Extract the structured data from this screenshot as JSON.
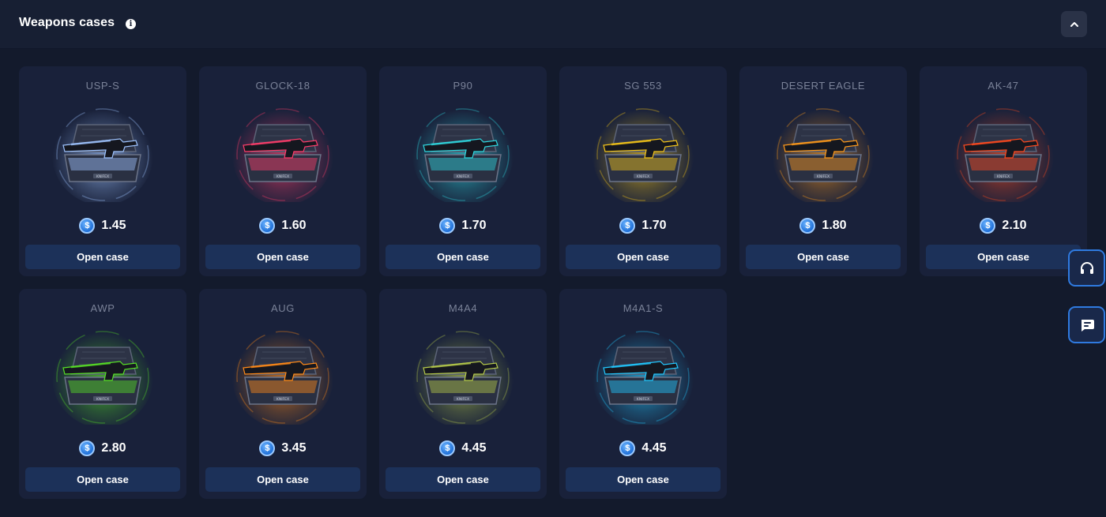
{
  "header": {
    "title": "Weapons cases",
    "info_icon": "info-icon",
    "collapse_icon": "chevron-up-icon"
  },
  "coin_symbol": "$",
  "cases": [
    {
      "name": "USP-S",
      "price": "1.45",
      "button": "Open case",
      "color": "#9fc4ff"
    },
    {
      "name": "GLOCK-18",
      "price": "1.60",
      "button": "Open case",
      "color": "#ff3d6a"
    },
    {
      "name": "P90",
      "price": "1.70",
      "button": "Open case",
      "color": "#2fd8e0"
    },
    {
      "name": "SG 553",
      "price": "1.70",
      "button": "Open case",
      "color": "#f5c518"
    },
    {
      "name": "DESERT EAGLE",
      "price": "1.80",
      "button": "Open case",
      "color": "#ff9a1a"
    },
    {
      "name": "AK-47",
      "price": "2.10",
      "button": "Open case",
      "color": "#ff4a1e"
    },
    {
      "name": "AWP",
      "price": "2.80",
      "button": "Open case",
      "color": "#57e026"
    },
    {
      "name": "AUG",
      "price": "3.45",
      "button": "Open case",
      "color": "#ff8a18"
    },
    {
      "name": "M4A4",
      "price": "4.45",
      "button": "Open case",
      "color": "#b5c94a"
    },
    {
      "name": "M4A1-S",
      "price": "4.45",
      "button": "Open case",
      "color": "#22c8ff"
    }
  ],
  "side_buttons": {
    "support_icon": "headset-icon",
    "chat_icon": "chat-icon"
  },
  "colors": {
    "background": "#131a2c",
    "card": "#19213a",
    "button": "#1c3159",
    "accent": "#2f7ae0"
  }
}
